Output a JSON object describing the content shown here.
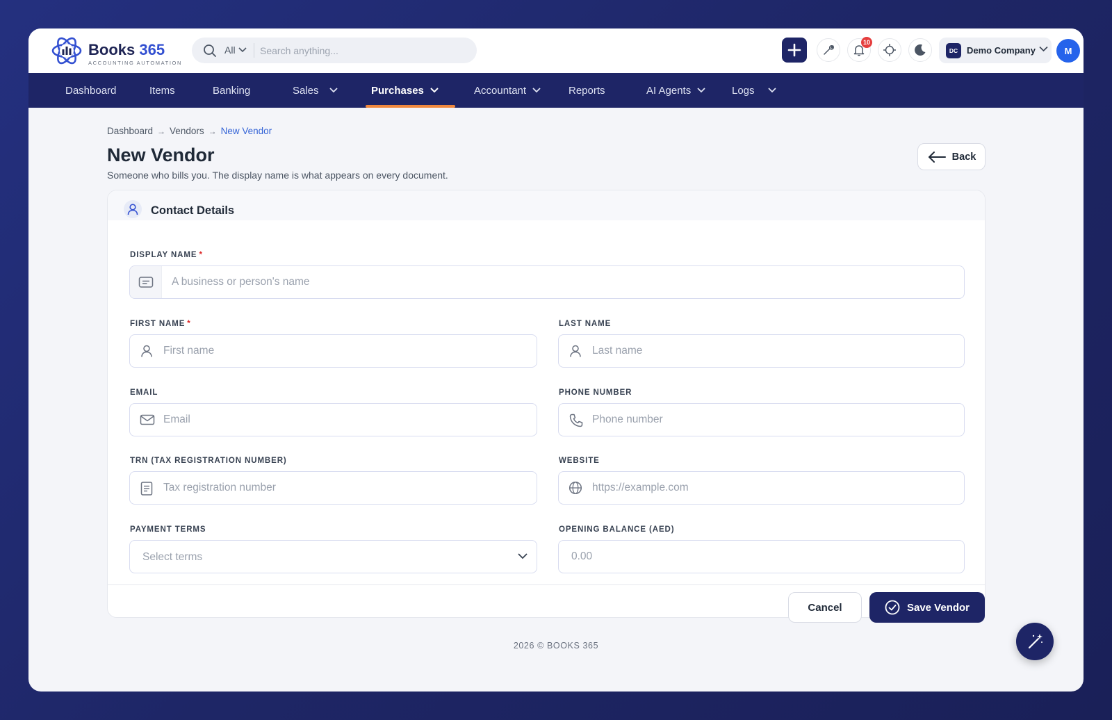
{
  "app": {
    "brand_prefix": "Books",
    "brand_suffix": "365",
    "tagline": "ACCOUNTING AUTOMATION",
    "colors": {
      "primary": "#1e2566",
      "accent": "#3350d1",
      "active_tab_underline": "#f0883e",
      "required": "#dc2626"
    }
  },
  "search": {
    "scope": "All",
    "placeholder": "Search anything..."
  },
  "topbar": {
    "icons": [
      "plus-icon",
      "wrench-icon",
      "bell-icon",
      "crosshair-icon",
      "moon-icon"
    ],
    "notification_count": "10",
    "company_initials": "DC",
    "company_name": "Demo Company",
    "user_initial": "M"
  },
  "nav": {
    "items": [
      {
        "label": "Dashboard"
      },
      {
        "label": "Items"
      },
      {
        "label": "Banking"
      },
      {
        "label": "Sales"
      },
      {
        "label": "Purchases"
      },
      {
        "label": "Accountant"
      },
      {
        "label": "Reports"
      },
      {
        "label": "AI Agents"
      },
      {
        "label": "Logs"
      }
    ],
    "active": "Purchases"
  },
  "breadcrumb": [
    "Dashboard",
    "Vendors",
    "New Vendor"
  ],
  "page": {
    "title": "New Vendor",
    "subtitle": "Someone who bills you. The display name is what appears on every document.",
    "back_label": "Back"
  },
  "form": {
    "section_title": "Contact Details",
    "display_name": {
      "label": "DISPLAY NAME",
      "required": "*",
      "placeholder": "A business or person's name"
    },
    "first_name": {
      "label": "FIRST NAME",
      "required": "*",
      "placeholder": "First name"
    },
    "last_name": {
      "label": "LAST NAME",
      "placeholder": "Last name"
    },
    "email": {
      "label": "EMAIL",
      "placeholder": "Email"
    },
    "phone": {
      "label": "PHONE NUMBER",
      "placeholder": "Phone number"
    },
    "trn": {
      "label": "TRN (TAX REGISTRATION NUMBER)",
      "placeholder": "Tax registration number"
    },
    "website": {
      "label": "WEBSITE",
      "placeholder": "https://example.com"
    },
    "payment_terms": {
      "label": "PAYMENT TERMS",
      "selected": "Select terms"
    },
    "opening_balance": {
      "label": "OPENING BALANCE (AED)",
      "placeholder": "0.00"
    }
  },
  "actions": {
    "cancel": "Cancel",
    "save": "Save Vendor"
  },
  "footer": "2026 © BOOKS 365"
}
